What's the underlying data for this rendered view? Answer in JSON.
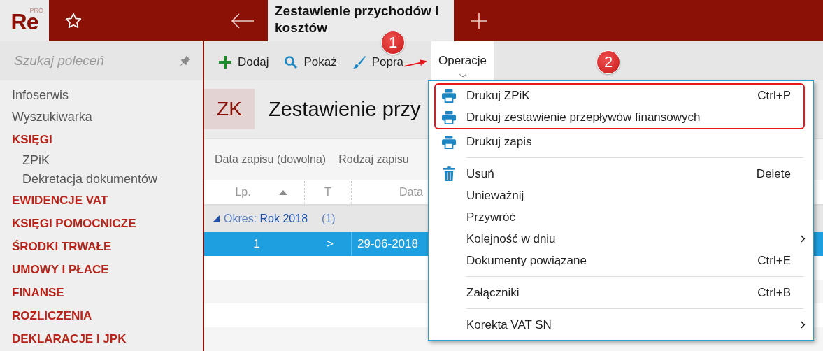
{
  "app": {
    "logo": "Re",
    "edition": "PRO"
  },
  "tab": {
    "title": "Zestawienie przychodów i kosztów"
  },
  "sidebar": {
    "search": {
      "placeholder": "Szukaj poleceń"
    },
    "items": [
      {
        "label": "Infoserwis",
        "kind": "link"
      },
      {
        "label": "Wyszukiwarka",
        "kind": "link"
      },
      {
        "label": "KSIĘGI",
        "kind": "section",
        "children": [
          {
            "label": "ZPiK"
          },
          {
            "label": "Dekretacja dokumentów"
          }
        ]
      },
      {
        "label": "EWIDENCJE VAT",
        "kind": "section"
      },
      {
        "label": "KSIĘGI POMOCNICZE",
        "kind": "section"
      },
      {
        "label": "ŚRODKI TRWAŁE",
        "kind": "section"
      },
      {
        "label": "UMOWY I PŁACE",
        "kind": "section"
      },
      {
        "label": "FINANSE",
        "kind": "section"
      },
      {
        "label": "ROZLICZENIA",
        "kind": "section"
      },
      {
        "label": "DEKLARACJE I JPK",
        "kind": "section"
      }
    ]
  },
  "toolbar": [
    {
      "label": "Dodaj",
      "kind": "plus",
      "selected": false
    },
    {
      "label": "Pokaż",
      "kind": "search",
      "selected": false
    },
    {
      "label": "Popra",
      "kind": "brush",
      "selected": false
    },
    {
      "label": "Operacje",
      "kind": "none",
      "selected": true
    }
  ],
  "document": {
    "badge": "ZK",
    "title": "Zestawienie przy"
  },
  "filters": [
    "Data zapisu (dowolna)",
    "Rodzaj zapisu"
  ],
  "table": {
    "columns": [
      {
        "label": "Lp.",
        "sorted": true
      },
      {
        "label": "T",
        "sorted": false
      },
      {
        "label": "Data",
        "sorted": false
      }
    ],
    "group": {
      "label": "Okres:",
      "value": "Rok 2018",
      "count": "(1)",
      "expanded": true
    },
    "rows": [
      {
        "cells": [
          "1",
          ">",
          "29-06-2018"
        ],
        "selected": true
      }
    ]
  },
  "menu": {
    "groups": [
      {
        "items": [
          {
            "label": "Drukuj ZPiK",
            "shortcut": "Ctrl+P",
            "kind": "printer",
            "highlighted": true,
            "submenu": false
          },
          {
            "label": "Drukuj zestawienie przepływów finansowych",
            "kind": "printer",
            "highlighted": true,
            "submenu": false
          },
          {
            "label": "Drukuj zapis",
            "kind": "printer",
            "highlighted": false,
            "submenu": false
          }
        ]
      },
      {
        "items": [
          {
            "label": "Usuń",
            "shortcut": "Delete",
            "kind": "trash",
            "highlighted": false,
            "submenu": false
          },
          {
            "label": "Unieważnij",
            "kind": "plain",
            "highlighted": false,
            "submenu": false
          },
          {
            "label": "Przywróć",
            "kind": "plain",
            "highlighted": false,
            "submenu": false
          },
          {
            "label": "Kolejność w dniu",
            "kind": "plain",
            "highlighted": false,
            "submenu": true
          },
          {
            "label": "Dokumenty powiązane",
            "shortcut": "Ctrl+E",
            "kind": "plain",
            "highlighted": false,
            "submenu": false
          }
        ]
      },
      {
        "items": [
          {
            "label": "Załączniki",
            "shortcut": "Ctrl+B",
            "kind": "plain",
            "highlighted": false,
            "submenu": false
          }
        ]
      },
      {
        "items": [
          {
            "label": "Korekta VAT SN",
            "kind": "plain",
            "highlighted": false,
            "submenu": true
          }
        ]
      }
    ]
  },
  "annotations": [
    {
      "label": "1"
    },
    {
      "label": "2"
    }
  ]
}
